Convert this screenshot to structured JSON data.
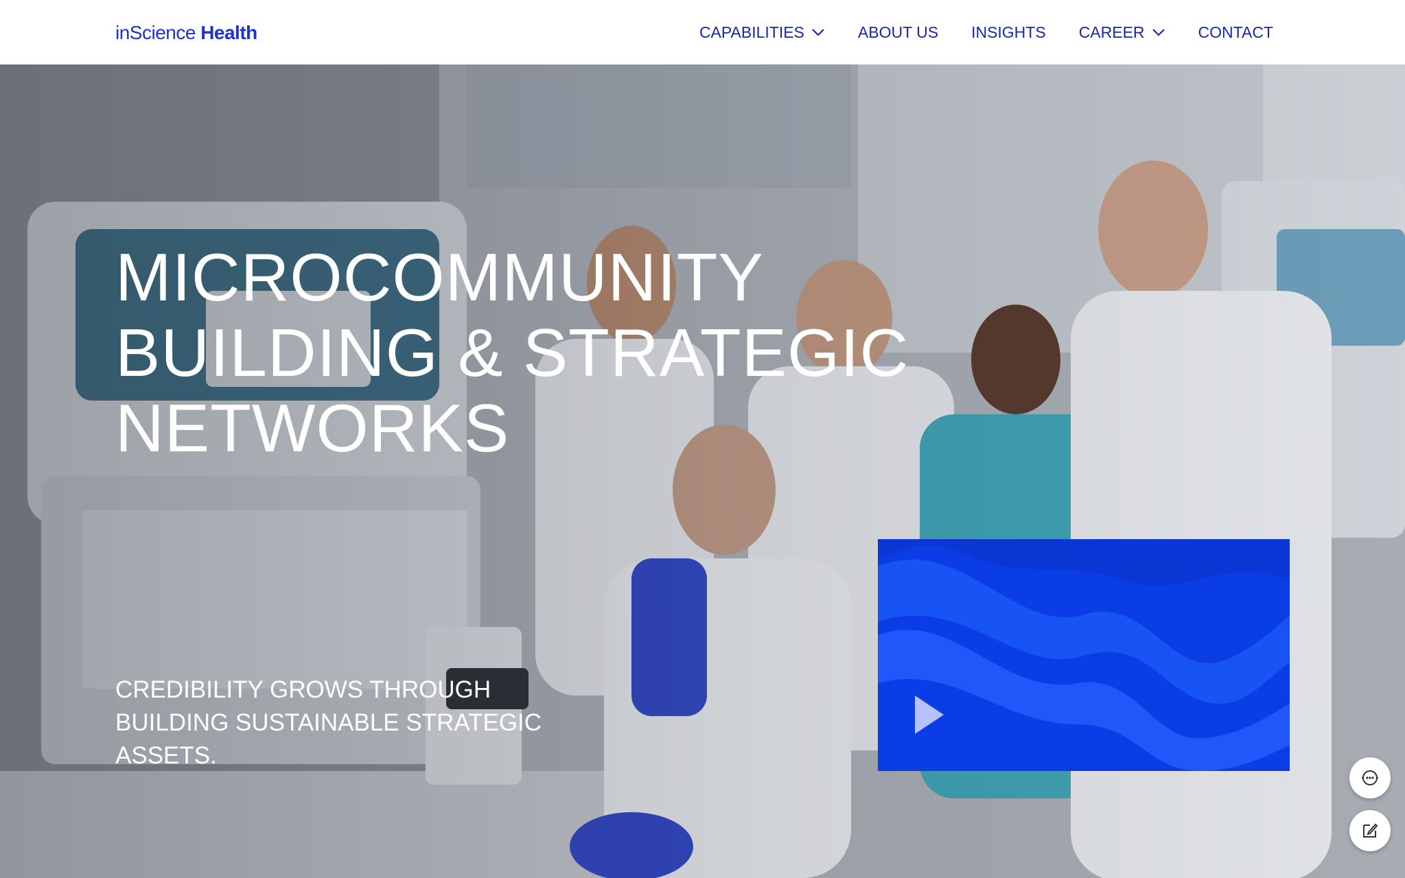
{
  "brand": {
    "logo_light": "inScience",
    "logo_bold": "Health",
    "color": "#1d33c9"
  },
  "nav": {
    "items": [
      {
        "label": "CAPABILITIES",
        "has_dropdown": true
      },
      {
        "label": "ABOUT US",
        "has_dropdown": false
      },
      {
        "label": "INSIGHTS",
        "has_dropdown": false
      },
      {
        "label": "CAREER",
        "has_dropdown": true
      },
      {
        "label": "CONTACT",
        "has_dropdown": false
      }
    ],
    "color": "#1627a8"
  },
  "hero": {
    "title_lines": [
      "MICROCOMMUNITY",
      "BUILDING & STRATEGIC",
      "NETWORKS"
    ],
    "subtitle_lines": [
      "CREDIBILITY GROWS THROUGH",
      "BUILDING SUSTAINABLE STRATEGIC",
      "ASSETS."
    ],
    "video_color": "#0b3de6",
    "play_icon": "play-icon"
  },
  "floating": {
    "chat_icon": "chat-bot-icon",
    "edit_icon": "feedback-edit-icon"
  }
}
